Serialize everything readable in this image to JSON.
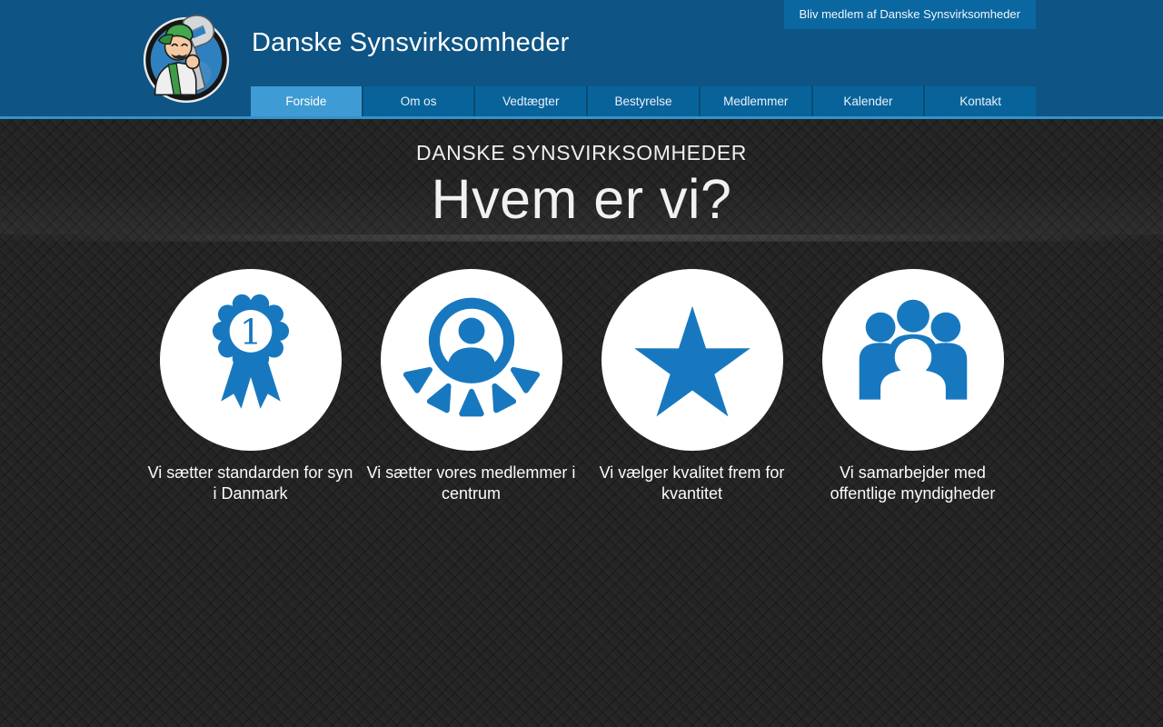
{
  "header": {
    "site_title": "Danske Synsvirksomheder",
    "join_button_label": "Bliv medlem af Danske Synsvirksomheder",
    "logo": "mechanic-mascot-logo",
    "nav": [
      {
        "label": "Forside",
        "active": true
      },
      {
        "label": "Om os",
        "active": false
      },
      {
        "label": "Vedtægter",
        "active": false
      },
      {
        "label": "Bestyrelse",
        "active": false
      },
      {
        "label": "Medlemmer",
        "active": false
      },
      {
        "label": "Kalender",
        "active": false
      },
      {
        "label": "Kontakt",
        "active": false
      }
    ]
  },
  "hero": {
    "kicker": "DANSKE SYNSVIRKSOMHEDER",
    "title": "Hvem er vi?"
  },
  "features": [
    {
      "icon": "award-ribbon-icon",
      "badge_number": "1",
      "caption": "Vi sætter standarden for syn i Danmark"
    },
    {
      "icon": "member-focus-icon",
      "caption": "Vi sætter vores medlemmer i centrum"
    },
    {
      "icon": "star-icon",
      "caption": "Vi vælger kvalitet frem for kvantitet"
    },
    {
      "icon": "team-icon",
      "caption": "Vi samarbejder med offentlige myndigheder"
    }
  ],
  "colors": {
    "header_bg": "#0E5484",
    "tab_bg": "#09639B",
    "tab_active_bg": "#3F9BD3",
    "header_underline": "#3093CC",
    "join_button_bg": "#0B67A0",
    "icon_blue": "#1878BF",
    "body_bg": "#242424",
    "text_light": "#F1F1F1"
  }
}
